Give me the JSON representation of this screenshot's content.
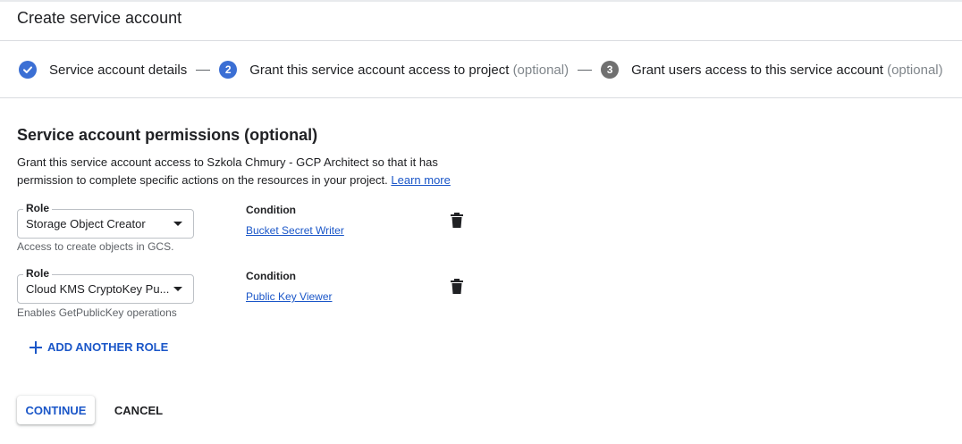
{
  "page": {
    "title": "Create service account"
  },
  "stepper": {
    "steps": [
      {
        "number": "",
        "label": "Service account details",
        "optional": "",
        "status": "done"
      },
      {
        "number": "2",
        "label": "Grant this service account access to project",
        "optional": "(optional)",
        "status": "active"
      },
      {
        "number": "3",
        "label": "Grant users access to this service account",
        "optional": "(optional)",
        "status": "inactive"
      }
    ]
  },
  "permissions": {
    "title": "Service account permissions (optional)",
    "description": "Grant this service account access to Szkola Chmury - GCP Architect so that it has permission to complete specific actions on the resources in your project.",
    "learn_more": "Learn more",
    "roles": [
      {
        "legend": "Role",
        "value": "Storage Object Creator",
        "hint": "Access to create objects in GCS.",
        "condition_label": "Condition",
        "condition_value": "Bucket Secret Writer"
      },
      {
        "legend": "Role",
        "value": "Cloud KMS CryptoKey Pu...",
        "hint": "Enables GetPublicKey operations",
        "condition_label": "Condition",
        "condition_value": "Public Key Viewer"
      }
    ],
    "add_role_label": "ADD ANOTHER ROLE"
  },
  "actions": {
    "continue_label": "CONTINUE",
    "cancel_label": "CANCEL"
  },
  "colors": {
    "accent": "#1a56c8",
    "step_active": "#3b6fd4",
    "step_inactive": "#707070"
  },
  "icons": {
    "step_done": "check-circle-icon",
    "delete": "trash-icon",
    "add": "plus-icon",
    "dropdown": "arrow-drop-down-icon"
  }
}
